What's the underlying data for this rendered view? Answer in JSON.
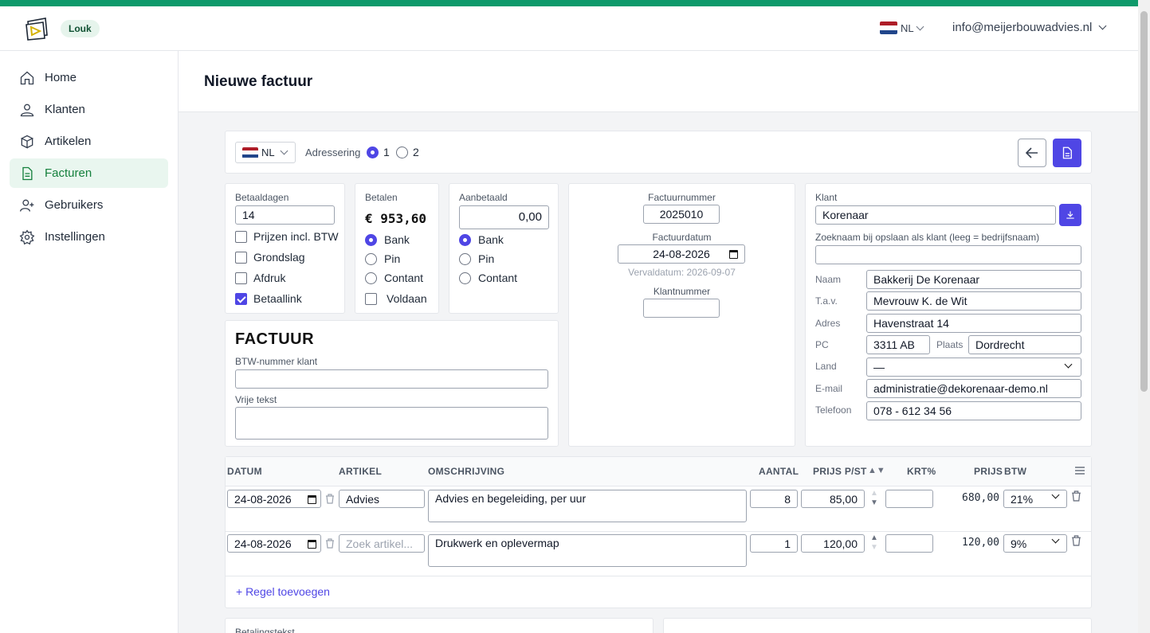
{
  "header": {
    "user_badge": "Louk",
    "language": "NL",
    "account_email": "info@meijerbouwadvies.nl"
  },
  "colors": {
    "brand": "#0f9a6b",
    "accent": "#4f46e5",
    "nav_active_bg": "#e9f6ef"
  },
  "sidebar": {
    "items": [
      {
        "label": "Home",
        "icon": "home-icon"
      },
      {
        "label": "Klanten",
        "icon": "users-icon"
      },
      {
        "label": "Artikelen",
        "icon": "package-icon"
      },
      {
        "label": "Facturen",
        "icon": "document-icon",
        "active": true
      },
      {
        "label": "Gebruikers",
        "icon": "user-plus-icon"
      },
      {
        "label": "Instellingen",
        "icon": "gear-icon"
      }
    ]
  },
  "page": {
    "title": "Nieuwe factuur"
  },
  "toolbar": {
    "language": "NL",
    "addressing_label": "Adressering",
    "addressing_options": [
      "1",
      "2"
    ],
    "addressing_selected": "1"
  },
  "payment_days": {
    "label": "Betaaldagen",
    "value": "14",
    "checkboxes": [
      {
        "label": "Prijzen incl. BTW",
        "checked": false
      },
      {
        "label": "Grondslag",
        "checked": false
      },
      {
        "label": "Afdruk",
        "checked": false
      },
      {
        "label": "Betaallink",
        "checked": true
      }
    ]
  },
  "pay": {
    "label": "Betalen",
    "amount": "€ 953,60",
    "options": [
      "Bank",
      "Pin",
      "Contant"
    ],
    "selected": "Bank",
    "settled_label": "Voldaan",
    "settled": false
  },
  "prepaid": {
    "label": "Aanbetaald",
    "value": "0,00",
    "options": [
      "Bank",
      "Pin",
      "Contant"
    ],
    "selected": "Bank"
  },
  "invoice_meta": {
    "number_label": "Factuurnummer",
    "number": "2025010",
    "date_label": "Factuurdatum",
    "date": "24-08-2026",
    "due_text": "Vervaldatum: 2026-09-07",
    "customer_number_label": "Klantnummer",
    "customer_number": ""
  },
  "customer": {
    "label": "Klant",
    "value": "Korenaar",
    "search_name_label": "Zoeknaam bij opslaan als klant (leeg = bedrijfsnaam)",
    "search_name": "",
    "fields": {
      "naam_label": "Naam",
      "naam": "Bakkerij De Korenaar",
      "tav_label": "T.a.v.",
      "tav": "Mevrouw K. de Wit",
      "adres_label": "Adres",
      "adres": "Havenstraat 14",
      "pc_label": "PC",
      "pc": "3311 AB",
      "plaats_label": "Plaats",
      "plaats": "Dordrecht",
      "land_label": "Land",
      "land": "—",
      "email_label": "E-mail",
      "email": "administratie@dekorenaar-demo.nl",
      "telefoon_label": "Telefoon",
      "telefoon": "078 - 612 34 56"
    }
  },
  "document": {
    "title": "FACTUUR",
    "vat_label": "BTW-nummer klant",
    "vat": "",
    "free_text_label": "Vrije tekst",
    "free_text": ""
  },
  "lines": {
    "headers": {
      "datum": "DATUM",
      "artikel": "ARTIKEL",
      "omschrijving": "OMSCHRIJVING",
      "aantal": "AANTAL",
      "prijs": "PRIJS P/ST",
      "krt": "KRT%",
      "prijs_total": "PRIJS",
      "btw": "BTW"
    },
    "rows": [
      {
        "datum": "24-08-2026",
        "artikel": "Advies",
        "omschrijving": "Advies en begeleiding, per uur",
        "aantal": "8",
        "prijs": "85,00",
        "krt": "",
        "totaal": "680,00",
        "btw": "21%"
      },
      {
        "datum": "24-08-2026",
        "artikel": "",
        "artikel_placeholder": "Zoek artikel...",
        "omschrijving": "Drukwerk en oplevermap",
        "aantal": "1",
        "prijs": "120,00",
        "krt": "",
        "totaal": "120,00",
        "btw": "9%"
      }
    ],
    "add_label": "+ Regel toevoegen"
  },
  "footer": {
    "payment_text_label": "Betalingstekst"
  }
}
